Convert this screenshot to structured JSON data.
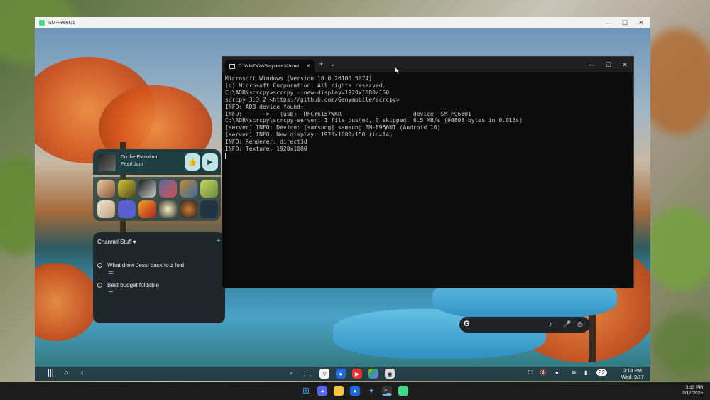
{
  "scrcpy_window": {
    "title": "SM-F966U1",
    "controls": {
      "minimize": "—",
      "maximize": "☐",
      "close": "✕"
    }
  },
  "music_widget": {
    "song": "Do the Evolution",
    "artist": "Pearl Jam",
    "like_icon": "thumbs-up-icon",
    "play_icon": "play-icon"
  },
  "app_grid": {
    "apps": [
      "app-1",
      "app-2",
      "app-3",
      "app-4",
      "app-5",
      "app-6",
      "app-7",
      "app-8",
      "app-9",
      "app-10",
      "app-11",
      "app-12"
    ]
  },
  "notes_widget": {
    "title": "Channel Stuff",
    "dropdown_glyph": "▾",
    "add_glyph": "+",
    "items": [
      {
        "text": "What drew Jessi back to z fold"
      },
      {
        "text": "Best budget foldable"
      }
    ]
  },
  "google_search": {
    "logo": "G",
    "icons": [
      "music-note-icon",
      "microphone-icon",
      "lens-icon"
    ]
  },
  "android_taskbar": {
    "time": "3:13 PM",
    "date": "Wed, 9/17",
    "battery": "82"
  },
  "cmd": {
    "tab_title": "C:\\WINDOWS\\system32\\cmd.",
    "tab_close": "✕",
    "new_tab": "+",
    "dropdown": "⌄",
    "lines": [
      "Microsoft Windows [Version 10.0.26100.5074]",
      "(c) Microsoft Corporation. All rights reserved.",
      "",
      "C:\\ADB\\scrcpy>scrcpy --new-display=1920x1080/150",
      "scrcpy 3.3.2 <https://github.com/Genymobile/scrcpy>",
      "INFO: ADB device found:",
      "INFO:     -->   (usb)  RFCY6157WKR                     device  SM_F966U1",
      "C:\\ADB\\scrcpy\\scrcpy-server: 1 file pushed, 0 skipped. 6.5 MB/s (90808 bytes in 0.013s)",
      "[server] INFO: Device: [samsung] samsung SM-F966U1 (Android 16)",
      "[server] INFO: New display: 1920x1080/150 (id=14)",
      "INFO: Renderer: direct3d",
      "INFO: Texture: 1920x1080"
    ]
  },
  "windows_taskbar": {
    "time": "3:13 PM",
    "date": "9/17/2025"
  },
  "colors": {
    "cmd_bg": "#0c0c0c",
    "cmd_text": "#cccccc",
    "widget_bg": "#1e3e42",
    "accent": "#bfe4e8"
  }
}
